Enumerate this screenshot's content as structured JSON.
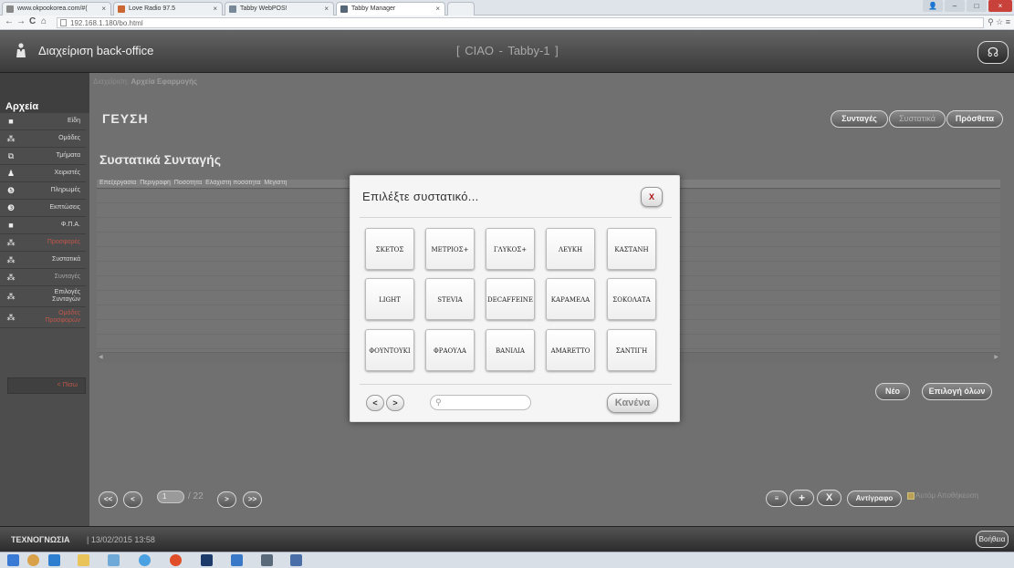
{
  "browser": {
    "tabs": [
      {
        "label": "www.okpookorea.com/#(",
        "active": false
      },
      {
        "label": "Love Radio 97.5",
        "active": false
      },
      {
        "label": "Tabby WebPOS!",
        "active": false
      },
      {
        "label": "Tabby Manager",
        "active": true
      }
    ],
    "url": "192.168.1.180/bo.html"
  },
  "header": {
    "title": "Διαχείριση back-office",
    "instance": "[ CIAO - Tabby-1 ]"
  },
  "sidebar": {
    "heading": "Αρχεία",
    "items": [
      {
        "label": "Είδη",
        "icon": "square-icon",
        "color": "normal"
      },
      {
        "label": "Ομάδες",
        "icon": "group-icon",
        "color": "normal"
      },
      {
        "label": "Τμήματα",
        "icon": "sections-icon",
        "color": "normal"
      },
      {
        "label": "Χειριστές",
        "icon": "user-icon",
        "color": "normal"
      },
      {
        "label": "Πληρωμές",
        "icon": "payments-icon",
        "color": "normal"
      },
      {
        "label": "Εκπτώσεις",
        "icon": "discount-icon",
        "color": "normal"
      },
      {
        "label": "Φ.Π.Α.",
        "icon": "square-icon",
        "color": "normal"
      },
      {
        "label": "Προσφορές",
        "icon": "group-icon",
        "color": "red"
      },
      {
        "label": "Συστατικά",
        "icon": "group-icon",
        "color": "normal"
      },
      {
        "label": "Συνταγές",
        "icon": "group-icon",
        "color": "normal"
      },
      {
        "label": "Επιλογές Συνταγών",
        "icon": "group-icon",
        "color": "normal"
      },
      {
        "label": "Ομάδες Προσφορών",
        "icon": "group-icon",
        "color": "red"
      }
    ],
    "back": "< Πίσω"
  },
  "main": {
    "breadcrumb_prefix": "Διαχείριση",
    "breadcrumb_page": "Αρχεία Εφαρμογής",
    "title": "ΓΕΥΣΗ",
    "tabs": [
      "Συνταγές",
      "Συστατικά",
      "Πρόσθετα"
    ],
    "active_tab": "Συστατικά",
    "section_title": "Συστατικά Συνταγής",
    "columns": [
      "Επεξεργασία",
      "Περιγραφή",
      "Ποσότητα",
      "Ελάχιστη ποσότητα",
      "Μέγιστη"
    ],
    "new_label": "Νέο",
    "select_all_label": "Επιλογή όλων",
    "pager": {
      "first": "<<",
      "prev": "<",
      "page": "1",
      "total": "/ 22",
      "next": ">",
      "last": ">>"
    },
    "toolbar": {
      "menu": "≡",
      "add": "+",
      "delete": "X",
      "copy": "Αντίγραφο"
    },
    "autosave_label": "Αυτόμ Αποθήκευση"
  },
  "modal": {
    "title": "Επιλέξτε συστατικό...",
    "close": "X",
    "ingredients": [
      "ΣΚΕΤΟΣ",
      "ΜΕΤΡΙΟΣ+",
      "ΓΛΥΚΟΣ+",
      "ΛΕΥΚΗ",
      "ΚΑΣΤΑΝΗ",
      "LIGHT",
      "STEVIA",
      "DECAFFEINE",
      "ΚΑΡΑΜΕΛΑ",
      "ΣΟΚΟΛΑΤΑ",
      "ΦΟΥΝΤΟΥΚΙ",
      "ΦΡΑΟΥΛΑ",
      "ΒΑΝΙΛΙΑ",
      "AMARETTO",
      "ΣΑΝΤΙΓΗ"
    ],
    "prev": "<",
    "next": ">",
    "search_placeholder": "",
    "none": "Κανένα"
  },
  "footer": {
    "company": "ΤΕΧΝΟΓΝΩΣΙΑ",
    "datetime": "| 13/02/2015 13:58",
    "help": "Βοήθεια"
  }
}
